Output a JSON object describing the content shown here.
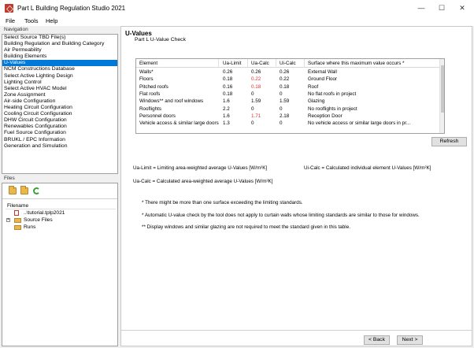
{
  "window": {
    "title": "Part L Building Regulation Studio 2021",
    "min_glyph": "—",
    "max_glyph": "☐",
    "close_glyph": "✕"
  },
  "menu": [
    "File",
    "Tools",
    "Help"
  ],
  "navigation": {
    "header": "Navigation",
    "selected_index": 4,
    "items": [
      "Select Source TBD File(s)",
      "Building Regulation and Building Category",
      "Air Permeability",
      "Building Elements",
      "U-Values",
      "NCM Constructions Database",
      "Select Active Lighting Design",
      "Lighting Control",
      "Select Active HVAC Model",
      "Zone Assignment",
      "Air-side Configuration",
      "Heating Circuit Configuration",
      "Cooling Circuit Configuration",
      "DHW Circuit Configuration",
      "Renewables Configuration",
      "Fuel Source Configuration",
      "BRUKL / EPC Information",
      "Generation and Simulation"
    ]
  },
  "files": {
    "header": "Files",
    "column": "Filename",
    "rows": [
      {
        "label": "..\\tutorial.tplp2021",
        "type": "file",
        "expander": ""
      },
      {
        "label": "Source Files",
        "type": "folder",
        "expander": "+"
      },
      {
        "label": "Runs",
        "type": "folder",
        "expander": ""
      }
    ]
  },
  "content": {
    "title": "U-Values",
    "subtitle": "Part L U-Value Check",
    "table": {
      "headers": [
        "Element",
        "Ua-Limit",
        "Ua-Calc",
        "Ui-Calc",
        "Surface where this maximum value occurs *"
      ],
      "rows": [
        {
          "element": "Walls*",
          "limit": "0.26",
          "ua": "0.26",
          "ui": "0.26",
          "surface": "External Wall",
          "ua_red": false
        },
        {
          "element": "Floors",
          "limit": "0.18",
          "ua": "0.22",
          "ui": "0.22",
          "surface": "Ground Floor",
          "ua_red": true
        },
        {
          "element": "Pitched roofs",
          "limit": "0.16",
          "ua": "0.18",
          "ui": "0.18",
          "surface": "Roof",
          "ua_red": true
        },
        {
          "element": "Flat roofs",
          "limit": "0.18",
          "ua": "0",
          "ui": "0",
          "surface": "No flat roofs in project",
          "ua_red": false
        },
        {
          "element": "Windows** and roof windows",
          "limit": "1.6",
          "ua": "1.59",
          "ui": "1.59",
          "surface": "Glazing",
          "ua_red": false
        },
        {
          "element": "Rooflights",
          "limit": "2.2",
          "ua": "0",
          "ui": "0",
          "surface": "No rooflights in project",
          "ua_red": false
        },
        {
          "element": "Personnel doors",
          "limit": "1.6",
          "ua": "1.71",
          "ui": "2.18",
          "surface": "Reception Door",
          "ua_red": true
        },
        {
          "element": "Vehicle access & similar large doors",
          "limit": "1.3",
          "ua": "0",
          "ui": "0",
          "surface": "No vehicle access or similar large doors in pr...",
          "ua_red": false
        }
      ]
    },
    "refresh_label": "Refresh",
    "definitions": {
      "ua_limit": "Ua-Limit = Limiting area-weighted average U-Values [W/m²K]",
      "ui_calc": "Ui-Calc = Calculated individual element U-Values [W/m²K]",
      "ua_calc": "Ua-Calc = Calculated area-weighted average U-Values [W/m²K]"
    },
    "notes": [
      "* There might be more than one surface exceeding the limiting standards.",
      "* Automatic U-value check by the tool does not apply to curtain walls whose limiting standards are similar to those for windows.",
      "** Display windows and similar glazing are not required to meet the standard given in this table."
    ],
    "back_label": "< Back",
    "next_label": "Next >"
  },
  "colors": {
    "selection": "#0078d7",
    "exceed_red": "#e03030",
    "brand_red": "#c0392b"
  }
}
